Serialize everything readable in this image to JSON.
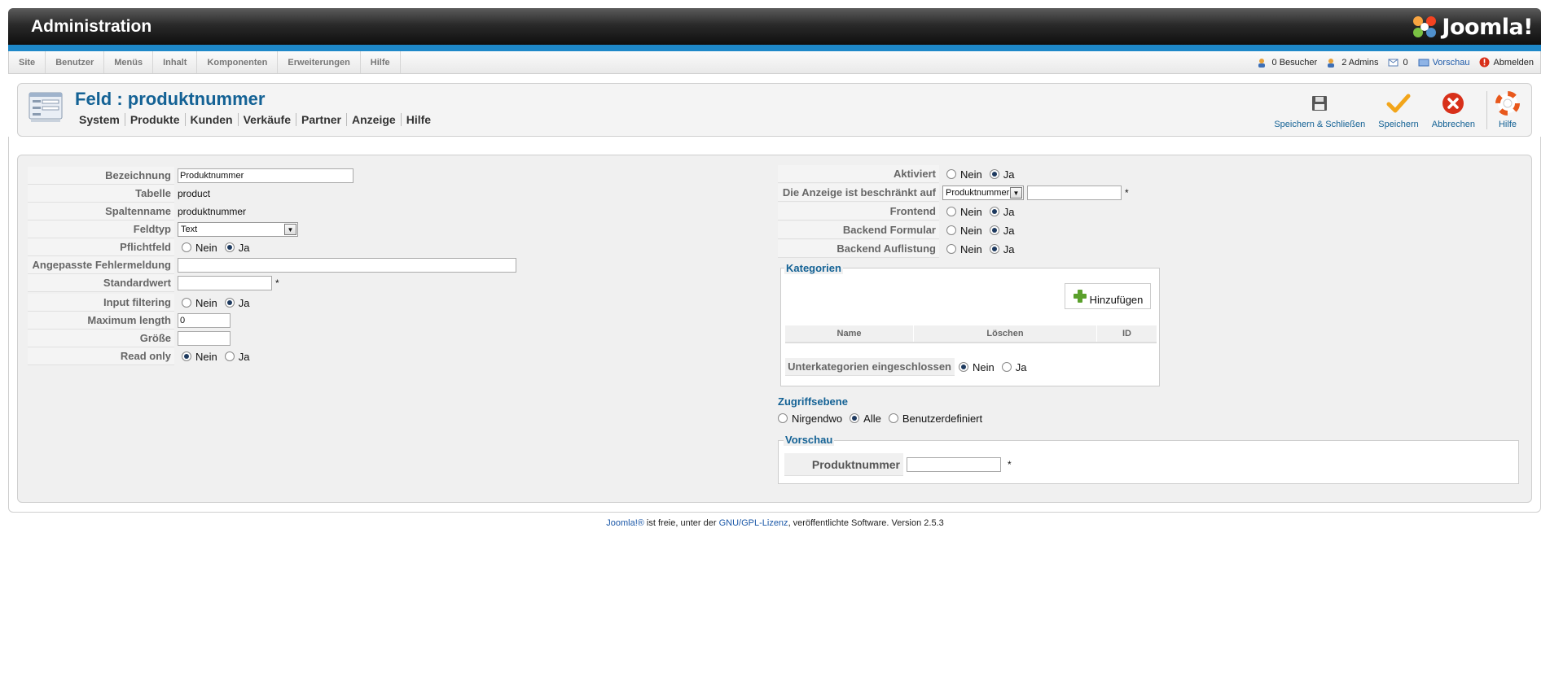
{
  "header": {
    "title": "Administration",
    "logo": "Joomla!"
  },
  "menu": [
    "Site",
    "Benutzer",
    "Menüs",
    "Inhalt",
    "Komponenten",
    "Erweiterungen",
    "Hilfe"
  ],
  "status": {
    "visitors": "0 Besucher",
    "admins": "2 Admins",
    "messages": "0",
    "preview": "Vorschau",
    "logout": "Abmelden"
  },
  "page": {
    "title": "Feld : produktnummer",
    "submenu": [
      "System",
      "Produkte",
      "Kunden",
      "Verkäufe",
      "Partner",
      "Anzeige",
      "Hilfe"
    ]
  },
  "toolbar": {
    "save_close": "Speichern & Schließen",
    "save": "Speichern",
    "cancel": "Abbrechen",
    "help": "Hilfe"
  },
  "left": {
    "bezeichnung": {
      "label": "Bezeichnung",
      "value": "Produktnummer"
    },
    "tabelle": {
      "label": "Tabelle",
      "value": "product"
    },
    "spaltenname": {
      "label": "Spaltenname",
      "value": "produktnummer"
    },
    "feldtyp": {
      "label": "Feldtyp",
      "value": "Text"
    },
    "pflichtfeld": {
      "label": "Pflichtfeld",
      "no": "Nein",
      "yes": "Ja",
      "selected": "Ja"
    },
    "fehlermeldung": {
      "label": "Angepasste Fehlermeldung",
      "value": ""
    },
    "standardwert": {
      "label": "Standardwert",
      "value": "",
      "required": "*"
    },
    "input_filtering": {
      "label": "Input filtering",
      "no": "Nein",
      "yes": "Ja",
      "selected": "Ja"
    },
    "max_length": {
      "label": "Maximum length",
      "value": "0"
    },
    "groesse": {
      "label": "Größe",
      "value": ""
    },
    "read_only": {
      "label": "Read only",
      "no": "Nein",
      "yes": "Ja",
      "selected": "Nein"
    }
  },
  "right": {
    "aktiviert": {
      "label": "Aktiviert",
      "no": "Nein",
      "yes": "Ja",
      "selected": "Ja"
    },
    "beschraenkt": {
      "label": "Die Anzeige ist beschränkt auf",
      "select_value": "Produktnummer",
      "input_value": "",
      "required": "*"
    },
    "frontend": {
      "label": "Frontend",
      "no": "Nein",
      "yes": "Ja",
      "selected": "Ja"
    },
    "backend_formular": {
      "label": "Backend Formular",
      "no": "Nein",
      "yes": "Ja",
      "selected": "Ja"
    },
    "backend_auflistung": {
      "label": "Backend Auflistung",
      "no": "Nein",
      "yes": "Ja",
      "selected": "Ja"
    },
    "kategorien": {
      "legend": "Kategorien",
      "add_button": "Hinzufügen",
      "columns": [
        "Name",
        "Löschen",
        "ID"
      ],
      "unterkategorien": {
        "label": "Unterkategorien eingeschlossen",
        "no": "Nein",
        "yes": "Ja",
        "selected": "Nein"
      }
    },
    "zugriffsebene": {
      "legend": "Zugriffsebene",
      "options": [
        "Nirgendwo",
        "Alle",
        "Benutzerdefiniert"
      ],
      "selected": "Alle"
    },
    "vorschau": {
      "legend": "Vorschau",
      "label": "Produktnummer",
      "value": "",
      "required": "*"
    }
  },
  "footer": {
    "joomla": "Joomla!®",
    "text1": " ist freie, unter der ",
    "license": "GNU/GPL-Lizenz",
    "text2": ", veröffentlichte Software. Version 2.5.3"
  }
}
